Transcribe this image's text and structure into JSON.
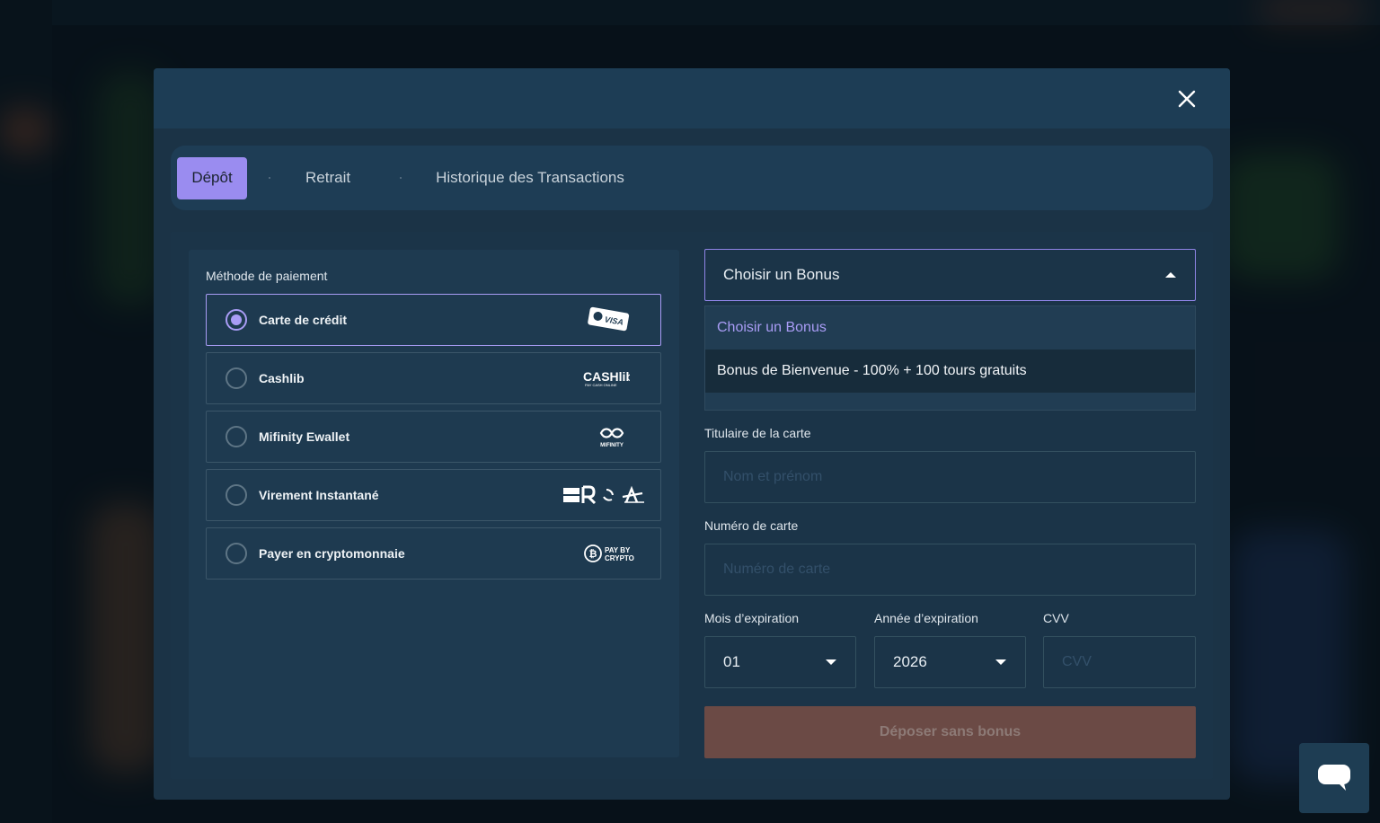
{
  "tabs": [
    {
      "label": "Dépôt",
      "active": true
    },
    {
      "label": "Retrait",
      "active": false
    },
    {
      "label": "Historique des Transactions",
      "active": false
    }
  ],
  "payment": {
    "title": "Méthode de paiement",
    "methods": [
      {
        "label": "Carte de crédit",
        "logo": "visa-card-icon",
        "selected": true
      },
      {
        "label": "Cashlib",
        "logo": "cashlib-logo",
        "selected": false
      },
      {
        "label": "Mifinity Ewallet",
        "logo": "mifinity-logo",
        "selected": false
      },
      {
        "label": "Virement Instantané",
        "logo": "instant-transfer-logos",
        "selected": false
      },
      {
        "label": "Payer en cryptomonnaie",
        "logo": "pay-by-crypto-logo",
        "selected": false
      }
    ],
    "logo_text": {
      "visa": "VISA",
      "cashlib": "CASHlib",
      "cashlib_sub": "PAY CASH ONLINE",
      "mifinity": "MIFINITY",
      "payby_line1": "PAY BY",
      "payby_line2": "CRYPTO"
    }
  },
  "bonus": {
    "selected": "Choisir un Bonus",
    "options": [
      "Choisir un Bonus",
      "Bonus de Bienvenue - 100% + 100 tours gratuits"
    ]
  },
  "form": {
    "holder_label": "Titulaire de la carte",
    "holder_placeholder": "Nom et prénom",
    "card_label": "Numéro de carte",
    "card_placeholder": "Numéro de carte",
    "month_label": "Mois d’expiration",
    "month_value": "01",
    "year_label": "Année d’expiration",
    "year_value": "2026",
    "cvv_label": "CVV",
    "cvv_placeholder": "CVV",
    "submit_label": "Déposer sans bonus"
  },
  "colors": {
    "accent": "#9a8cf0",
    "modal_bg": "#1b3346",
    "submit_bg": "#6b4a45"
  }
}
